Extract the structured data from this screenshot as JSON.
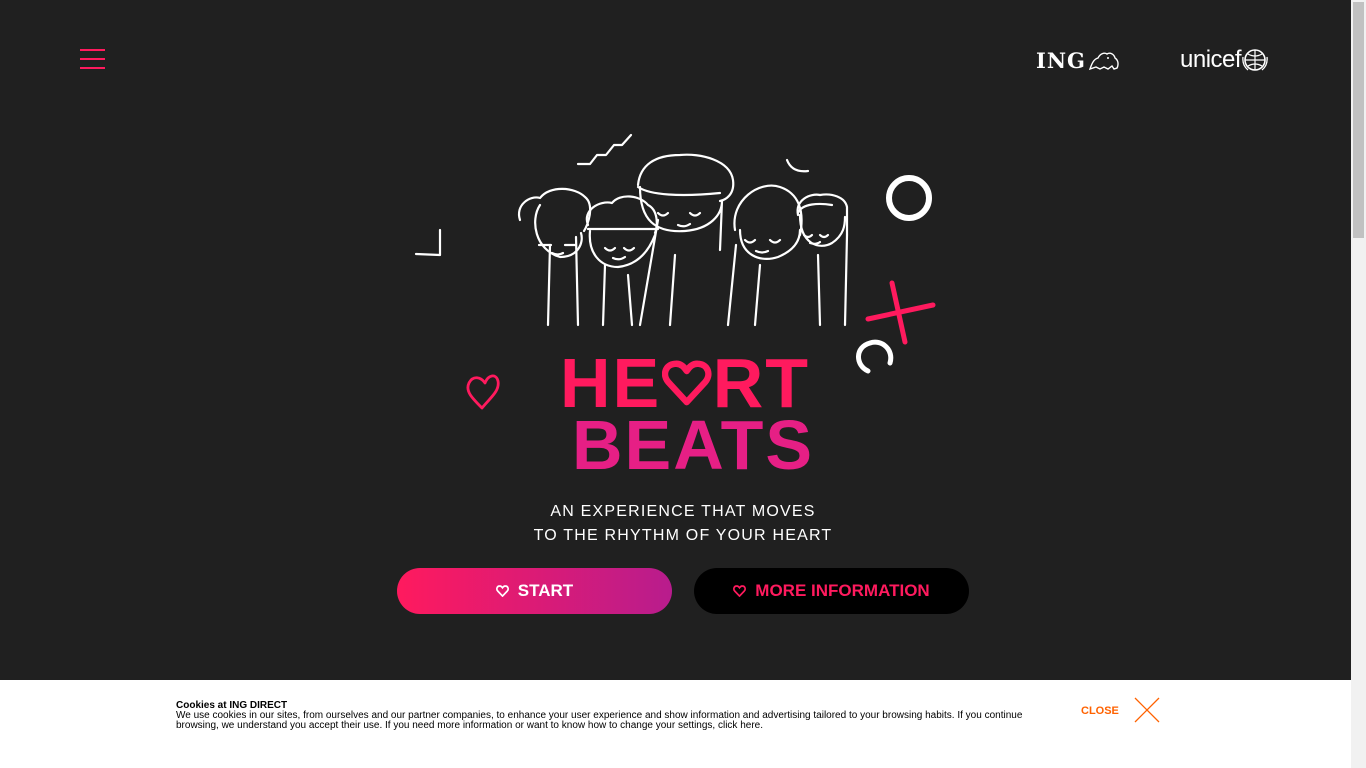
{
  "header": {
    "menu_icon": "hamburger-menu-icon",
    "ing_logo_text": "ING",
    "unicef_logo_text": "unicef"
  },
  "hero": {
    "title_line1_left": "HE",
    "title_line1_right": "RT",
    "title_line2": "BEATS",
    "subtitle_line1": "AN EXPERIENCE THAT MOVES",
    "subtitle_line2": "TO THE RHYTHM OF YOUR HEART"
  },
  "buttons": {
    "start_label": "START",
    "more_info_label": "MORE INFORMATION"
  },
  "cookie": {
    "title": "Cookies at ING DIRECT",
    "body": "We use cookies in our sites, from ourselves and our partner companies, to enhance your user experience and show information and advertising tailored to your browsing habits. If you continue browsing, we understand you accept their use. If you need more information or want to know how to change your settings, click here.",
    "close_label": "CLOSE"
  },
  "colors": {
    "background": "#202020",
    "accent_pink": "#ff1a5e",
    "accent_magenta": "#b81c8d",
    "cookie_orange": "#ff6200"
  }
}
